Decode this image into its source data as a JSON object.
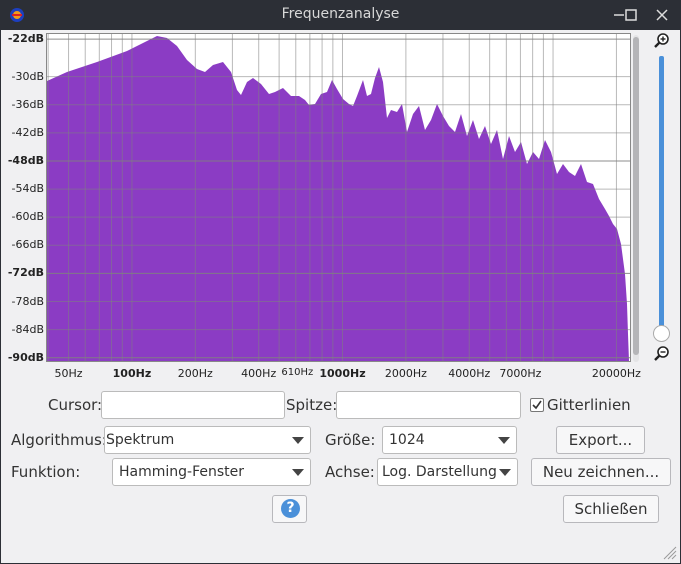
{
  "window": {
    "title": "Frequenzanalyse"
  },
  "plot": {
    "fill_color": "#8b3cc4",
    "y_labels": [
      {
        "text": "-22dB",
        "db": -22,
        "bold": true
      },
      {
        "text": "-30dB",
        "db": -30,
        "bold": false
      },
      {
        "text": "-36dB",
        "db": -36,
        "bold": false
      },
      {
        "text": "-42dB",
        "db": -42,
        "bold": false
      },
      {
        "text": "-48dB",
        "db": -48,
        "bold": true
      },
      {
        "text": "-54dB",
        "db": -54,
        "bold": false
      },
      {
        "text": "-60dB",
        "db": -60,
        "bold": false
      },
      {
        "text": "-66dB",
        "db": -66,
        "bold": false
      },
      {
        "text": "-72dB",
        "db": -72,
        "bold": true
      },
      {
        "text": "-78dB",
        "db": -78,
        "bold": false
      },
      {
        "text": "-84dB",
        "db": -84,
        "bold": false
      },
      {
        "text": "-90dB",
        "db": -90,
        "bold": true
      }
    ],
    "x_labels": [
      {
        "text": "50Hz",
        "hz": 50,
        "style": "normal"
      },
      {
        "text": "100Hz",
        "hz": 100,
        "style": "bold"
      },
      {
        "text": "200Hz",
        "hz": 200,
        "style": "normal"
      },
      {
        "text": "400Hz",
        "hz": 400,
        "style": "normal"
      },
      {
        "text": "610Hz",
        "hz": 610,
        "style": "small"
      },
      {
        "text": "1000Hz",
        "hz": 1000,
        "style": "bold"
      },
      {
        "text": "2000Hz",
        "hz": 2000,
        "style": "normal"
      },
      {
        "text": "4000Hz",
        "hz": 4000,
        "style": "normal"
      },
      {
        "text": "7000Hz",
        "hz": 7000,
        "style": "normal"
      },
      {
        "text": "20000Hz",
        "hz": 20000,
        "style": "normal"
      }
    ]
  },
  "controls": {
    "cursor_label": "Cursor:",
    "cursor_value": "",
    "peak_label": "Spitze:",
    "peak_value": "",
    "grid_label": "Gitterlinien",
    "grid_checked": true,
    "algorithm_label": "Algorithmus:",
    "algorithm_value": "Spektrum",
    "size_label": "Größe:",
    "size_value": "1024",
    "export_label": "Export...",
    "function_label": "Funktion:",
    "function_value": "Hamming-Fenster",
    "axis_label": "Achse:",
    "axis_value": "Log. Darstellung",
    "replot_label": "Neu zeichnen...",
    "help_label": "?",
    "close_label": "Schließen"
  }
}
